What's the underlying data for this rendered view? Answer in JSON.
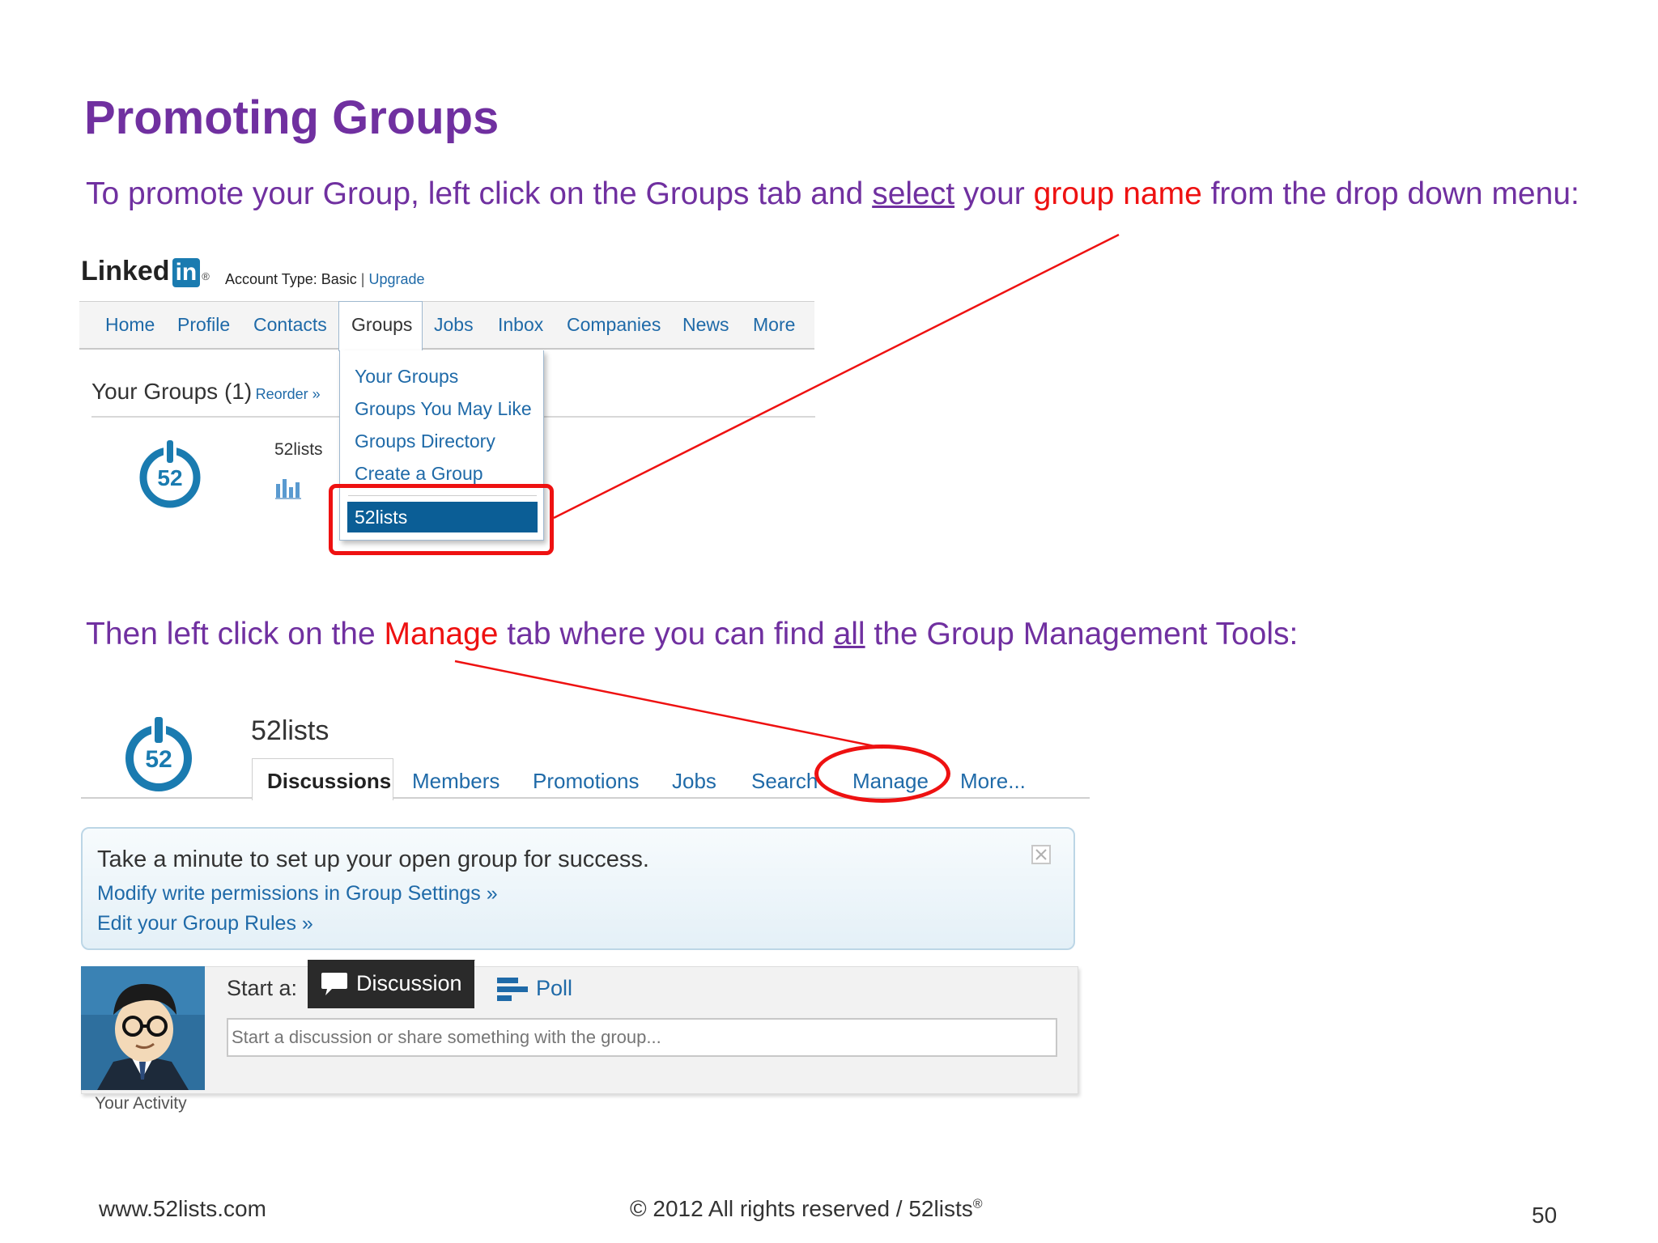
{
  "slide": {
    "title": "Promoting Groups",
    "instruction1": {
      "part1": "To promote your Group, left click on the Groups tab and ",
      "select_word": "select",
      "part2": " your ",
      "group_name": "group name",
      "part3": " from the drop down menu:"
    },
    "instruction2": {
      "part1": "Then left click on the ",
      "manage_word": "Manage",
      "part2": " tab where you can find ",
      "all_word": "all",
      "part3": " the Group Management Tools:"
    }
  },
  "linkedin": {
    "logo_text": "Linked",
    "logo_in": "in",
    "registered": "®",
    "account_type_label": "Account Type: Basic",
    "separator": "|",
    "upgrade": "Upgrade",
    "nav_tabs": [
      "Home",
      "Profile",
      "Contacts",
      "Groups",
      "Jobs",
      "Inbox",
      "Companies",
      "News",
      "More"
    ],
    "active_tab": "Groups",
    "your_groups": "Your Groups (1)",
    "reorder": "Reorder »",
    "group_label": "52lists",
    "group_logo_number": "52",
    "dropdown": {
      "items": [
        "Your Groups",
        "Groups You May Like",
        "Groups Directory",
        "Create a Group"
      ],
      "selected": "52lists"
    }
  },
  "group_page": {
    "logo_number": "52",
    "name": "52lists",
    "tabs": [
      "Discussions",
      "Members",
      "Promotions",
      "Jobs",
      "Search",
      "Manage",
      "More..."
    ],
    "active_tab": "Discussions",
    "highlighted_tab": "Manage",
    "notice": {
      "heading": "Take a minute to set up your open group for success.",
      "link1": "Modify write permissions in Group Settings »",
      "link2": "Edit your Group Rules »"
    },
    "composer": {
      "start_label": "Start a:",
      "discussion_button": "Discussion",
      "poll_button": "Poll",
      "placeholder": "Start a discussion or share something with the group..."
    },
    "your_activity": "Your Activity"
  },
  "footer": {
    "website": "www.52lists.com",
    "copyright": "© 2012 All rights reserved / 52lists",
    "registered": "®",
    "page_number": "50"
  },
  "colors": {
    "title_purple": "#7030a0",
    "highlight_red": "#ee1111",
    "linkedin_blue": "#1f6aa8",
    "selected_bg": "#0b5e96",
    "logo_blue": "#1a7bb0"
  }
}
